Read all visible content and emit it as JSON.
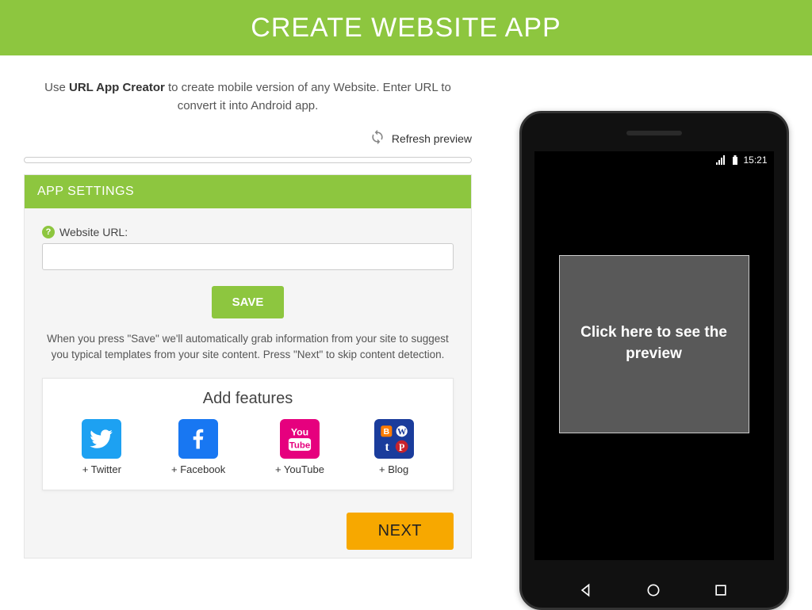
{
  "header": {
    "title": "CREATE WEBSITE APP"
  },
  "intro": {
    "prefix": "Use ",
    "bold": "URL App Creator",
    "rest": " to create mobile version of any Website. Enter URL to convert it into Android app."
  },
  "refresh": {
    "label": "Refresh preview"
  },
  "panel": {
    "title": "APP SETTINGS",
    "url_label": "Website URL:",
    "url_value": "",
    "save_label": "SAVE",
    "save_hint": "When you press \"Save\" we'll automatically grab information from your site to suggest you typical templates from your site content. Press \"Next\" to skip content detection.",
    "features_title": "Add features",
    "features": [
      {
        "name": "twitter",
        "label": "+ Twitter",
        "color": "#1da1f2"
      },
      {
        "name": "facebook",
        "label": "+ Facebook",
        "color": "#1877f2"
      },
      {
        "name": "youtube",
        "label": "+ YouTube",
        "color": "#e6007e"
      },
      {
        "name": "blog",
        "label": "+ Blog",
        "color": "#1a3c9c"
      }
    ],
    "next_label": "NEXT"
  },
  "phone": {
    "time": "15:21",
    "preview_cta": "Click here to see the preview"
  }
}
